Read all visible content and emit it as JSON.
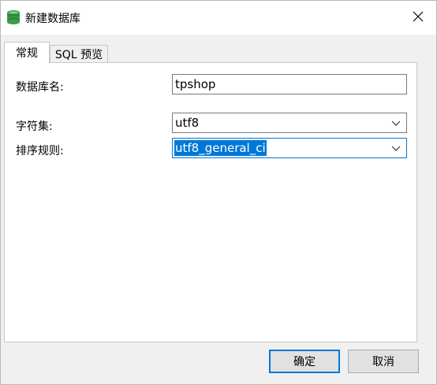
{
  "window": {
    "title": "新建数据库",
    "icon": "database-icon",
    "close_icon": "close-icon"
  },
  "tabs": [
    {
      "label": "常规",
      "active": true
    },
    {
      "label": "SQL 预览",
      "active": false
    }
  ],
  "form": {
    "db_name_label": "数据库名:",
    "db_name_value": "tpshop",
    "charset_label": "字符集:",
    "charset_value": "utf8",
    "collation_label": "排序规则:",
    "collation_value": "utf8_general_ci"
  },
  "buttons": {
    "ok_label": "确定",
    "cancel_label": "取消"
  },
  "colors": {
    "accent": "#0078d7",
    "icon_green": "#3aa04a"
  }
}
